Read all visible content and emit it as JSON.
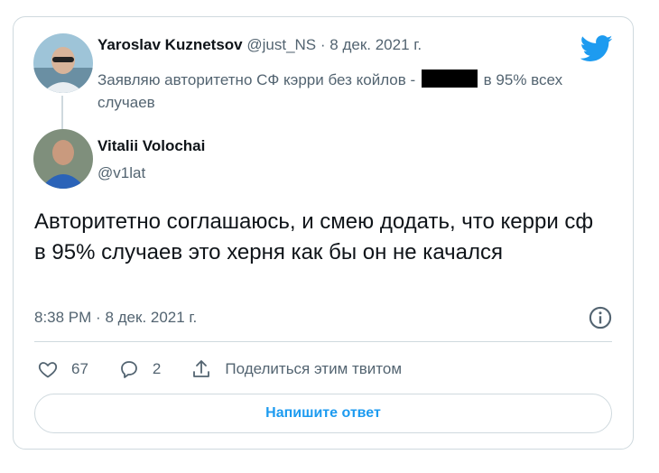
{
  "quoted": {
    "author_name": "Yaroslav Kuznetsov",
    "handle": "@just_NS",
    "separator": "·",
    "date": "8 дек. 2021 г.",
    "text_before": "Заявляю авторитетно СФ кэрри без койлов -",
    "text_after": "в 95% всех случаев"
  },
  "tweet": {
    "author_name": "Vitalii Volochai",
    "handle": "@v1lat",
    "text": "Авторитетно соглашаюсь, и смею додать, что керри сф в 95% случаев это херня как бы он не качался",
    "time": "8:38 PM",
    "separator": "·",
    "date": "8 дек. 2021 г."
  },
  "actions": {
    "likes": "67",
    "replies": "2",
    "share_label": "Поделиться этим твитом"
  },
  "reply_button_label": "Напишите ответ",
  "colors": {
    "accent": "#1d9bf0",
    "muted": "#536471",
    "border": "#cfd9de"
  },
  "icons": [
    "twitter-logo-icon",
    "info-icon",
    "heart-icon",
    "reply-icon",
    "share-icon"
  ]
}
